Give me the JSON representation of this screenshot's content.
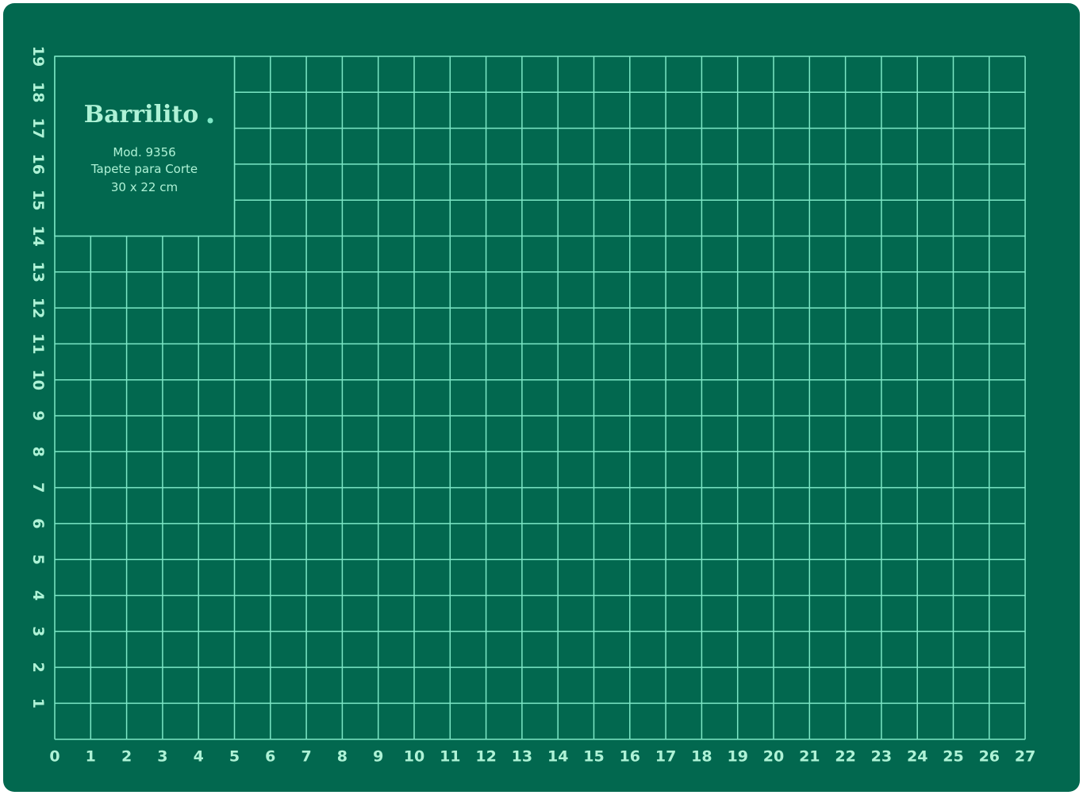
{
  "colors": {
    "mat": "#02684f",
    "grid": "#7de7c6",
    "text": "#aef2d6"
  },
  "label": {
    "brand": "Barrilito",
    "model": "Mod. 9356",
    "product": "Tapete para Corte",
    "size": "30 x 22 cm"
  },
  "ruler": {
    "x_labels": [
      "0",
      "1",
      "2",
      "3",
      "4",
      "5",
      "6",
      "7",
      "8",
      "9",
      "10",
      "11",
      "12",
      "13",
      "14",
      "15",
      "16",
      "17",
      "18",
      "19",
      "20",
      "21",
      "22",
      "23",
      "24",
      "25",
      "26",
      "27"
    ],
    "y_labels": [
      "1",
      "2",
      "3",
      "4",
      "5",
      "6",
      "7",
      "8",
      "9",
      "10",
      "11",
      "12",
      "13",
      "14",
      "15",
      "16",
      "17",
      "18",
      "19"
    ]
  }
}
